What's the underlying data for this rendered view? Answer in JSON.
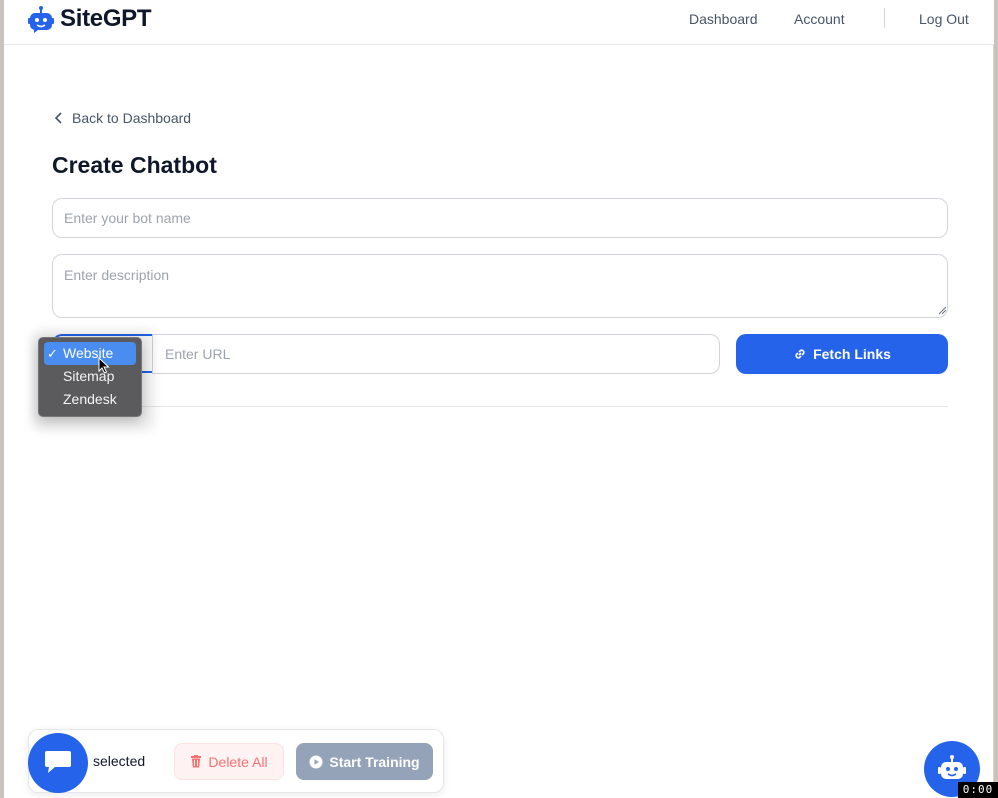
{
  "brand": {
    "name": "SiteGPT",
    "accent": "#2563eb"
  },
  "nav": {
    "dashboard": "Dashboard",
    "account": "Account",
    "logout": "Log Out"
  },
  "page": {
    "back_label": "Back to Dashboard",
    "title": "Create Chatbot"
  },
  "form": {
    "name_placeholder": "Enter your bot name",
    "description_placeholder": "Enter description",
    "url_placeholder": "Enter URL",
    "fetch_label": "Fetch Links"
  },
  "source_select": {
    "selected": "Website",
    "options": [
      "Website",
      "Sitemap",
      "Zendesk"
    ]
  },
  "bottom_bar": {
    "selected_label": "selected",
    "delete_label": "Delete All",
    "train_label": "Start Training"
  },
  "recording_timer": "0:00"
}
